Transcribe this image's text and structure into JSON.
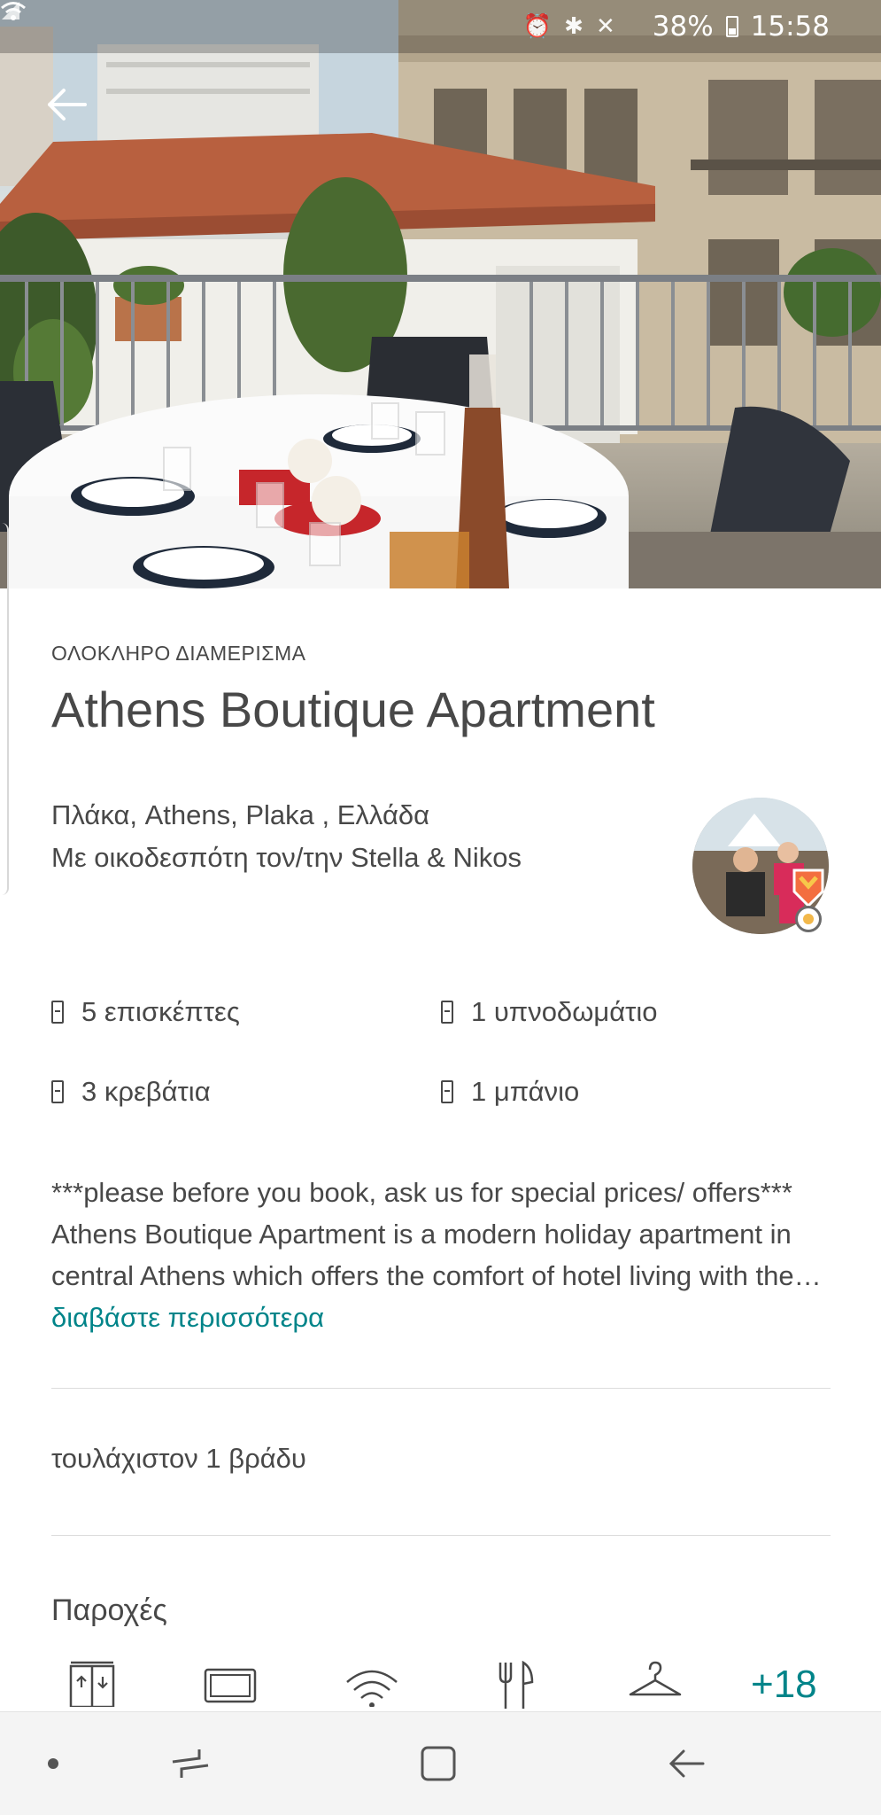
{
  "status_bar": {
    "battery": "38%",
    "time": "15:58",
    "icons": [
      "alarm-icon",
      "bluetooth-icon",
      "mute-icon",
      "wifi-icon",
      "signal-icon",
      "battery-icon"
    ]
  },
  "listing": {
    "kicker": "ΟΛΟΚΛΗΡΟ ΔΙΑΜΕΡΙΣΜΑ",
    "title": "Athens Boutique Apartment",
    "location": "Πλάκα, Athens, Plaka , Ελλάδα",
    "host_line": "Με οικοδεσπότη τον/την Stella & Nikos",
    "specs": [
      {
        "icon": "guests-icon",
        "label": "5 επισκέπτες"
      },
      {
        "icon": "bedroom-icon",
        "label": "1 υπνοδωμάτιο"
      },
      {
        "icon": "bed-icon",
        "label": "3 κρεβάτια"
      },
      {
        "icon": "bath-icon",
        "label": "1 μπάνιο"
      }
    ],
    "description": "***please before you book, ask us for special prices/ offers*** Athens Boutique Apartment is a modern holiday apartment in central Athens which offers the comfort of hotel living with the…",
    "read_more": "διαβάστε περισσότερα",
    "min_nights": "τουλάχιστον 1 βράδυ",
    "amenities_title": "Παροχές",
    "amenities": [
      "elevator-icon",
      "tv-icon",
      "wifi-icon",
      "kitchen-icon",
      "hanger-icon"
    ],
    "amenities_more": "+18"
  },
  "nav_bar": {
    "items": [
      "dot-icon",
      "recent-apps-icon",
      "home-icon",
      "back-icon"
    ]
  },
  "colors": {
    "text": "#484848",
    "accent": "#008489",
    "divider": "#dcdcdc",
    "nav_bg": "#f4f4f4"
  }
}
